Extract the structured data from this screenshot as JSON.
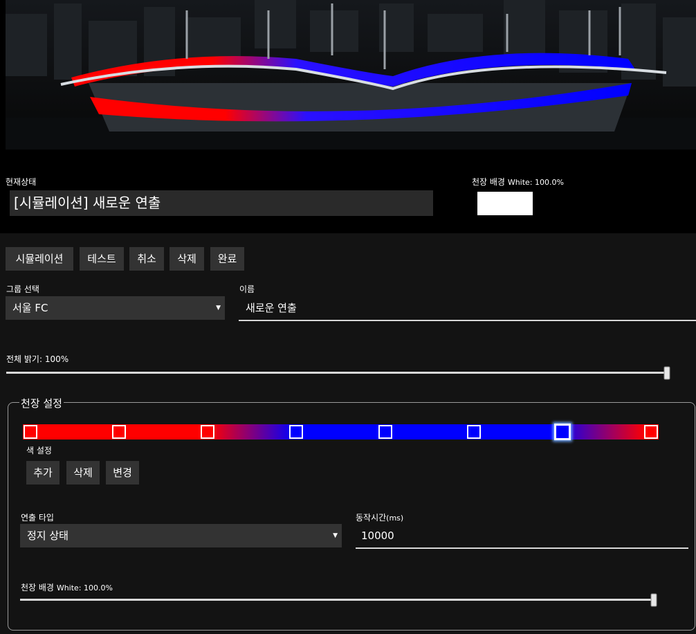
{
  "status": {
    "label": "현재상태",
    "value": "[시뮬레이션] 새로운 연출"
  },
  "ceiling_bg_header": {
    "label": "천장 배경",
    "value": "White: 100.0%",
    "color": "#ffffff"
  },
  "toolbar": {
    "simulate_label": "시뮬레이션",
    "test_label": "테스트",
    "cancel_label": "취소",
    "delete_label": "삭제",
    "done_label": "완료"
  },
  "group": {
    "label": "그룹 선택",
    "selected": "서울 FC"
  },
  "name": {
    "label": "이름",
    "value": "새로운 연출"
  },
  "brightness": {
    "label": "전체 밝기: 100%",
    "value": 1.0
  },
  "ceiling": {
    "legend": "천장 설정",
    "stops": [
      {
        "color": "#ff0000",
        "selected": false
      },
      {
        "color": "#ff0000",
        "selected": false
      },
      {
        "color": "#ff0000",
        "selected": false
      },
      {
        "color": "#0000ff",
        "selected": false
      },
      {
        "color": "#0000ff",
        "selected": false
      },
      {
        "color": "#0000ff",
        "selected": false
      },
      {
        "color": "#0000ff",
        "selected": true
      },
      {
        "color": "#ff0000",
        "selected": false
      }
    ],
    "color_setting_label": "색 설정",
    "add_label": "추가",
    "delete_label": "삭제",
    "change_label": "변경",
    "effect_type_label": "연출 타입",
    "effect_type_selected": "정지 상태",
    "duration_label": "동작시간",
    "duration_unit": "(ms)",
    "duration_value": "10000",
    "bg_label": "천장 배경",
    "bg_value": "White: 100.0%",
    "bg_level": 1.0
  }
}
